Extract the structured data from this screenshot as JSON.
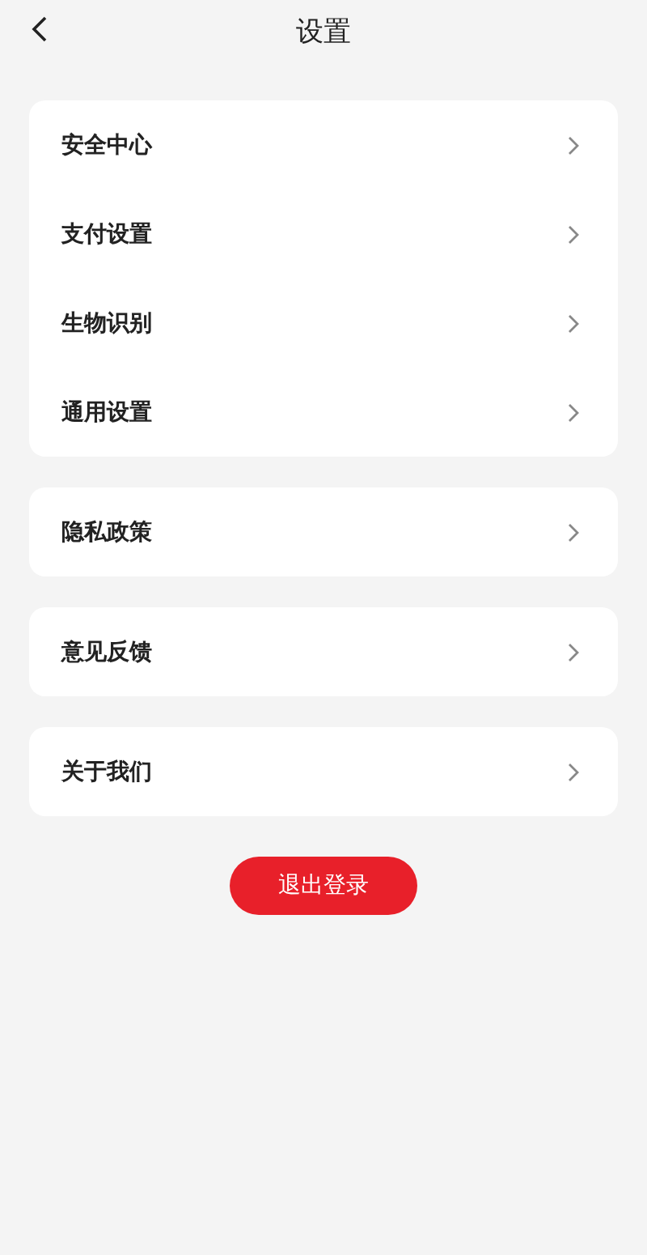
{
  "header": {
    "title": "设置"
  },
  "groups": [
    {
      "items": [
        {
          "label": "安全中心"
        },
        {
          "label": "支付设置"
        },
        {
          "label": "生物识别"
        },
        {
          "label": "通用设置"
        }
      ]
    },
    {
      "items": [
        {
          "label": "隐私政策"
        }
      ]
    },
    {
      "items": [
        {
          "label": "意见反馈"
        }
      ]
    },
    {
      "items": [
        {
          "label": "关于我们"
        }
      ]
    }
  ],
  "logout_button": {
    "label": "退出登录"
  }
}
